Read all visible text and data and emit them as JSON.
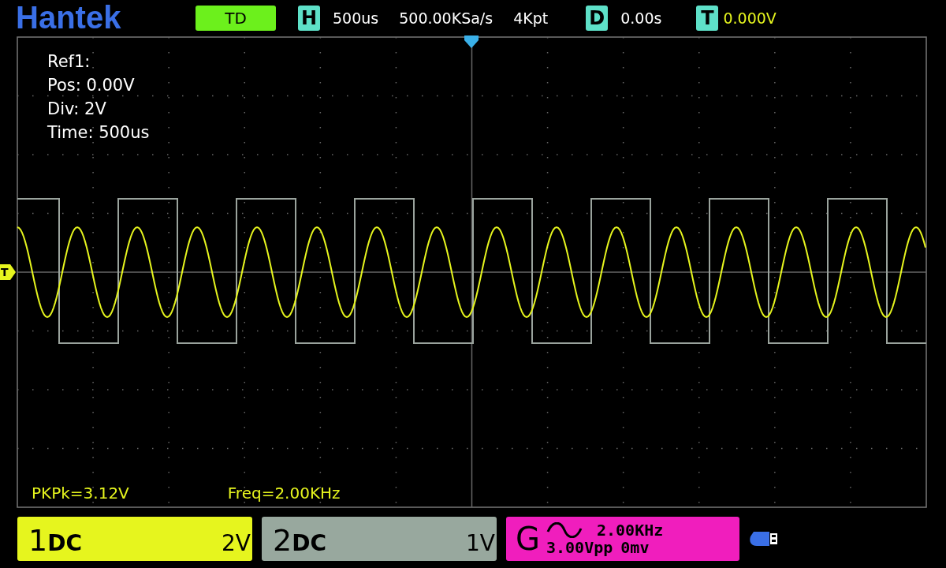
{
  "header": {
    "logo": "Hantek",
    "mode": "TD",
    "h_label": "H",
    "timebase": "500us",
    "sample_rate": "500.00KSa/s",
    "memory_depth": "4Kpt",
    "d_label": "D",
    "delay": "0.00s",
    "t_label": "T",
    "trigger_level": "0.000V"
  },
  "ref_info": [
    "Ref1:",
    "Pos: 0.00V",
    "Div: 2V",
    "Time: 500us"
  ],
  "trigger_marker": "T",
  "measurements": [
    "PKPk=3.12V",
    "Freq=2.00KHz"
  ],
  "channels": [
    {
      "number": "1",
      "coupling": "DC",
      "scale": "2V",
      "color": "#e6f51e"
    },
    {
      "number": "2",
      "coupling": "DC",
      "scale": "1V",
      "color": "#98a89e"
    }
  ],
  "generator": {
    "label": "G",
    "frequency": "2.00KHz",
    "amplitude": "3.00Vpp",
    "offset": "0mv"
  }
}
